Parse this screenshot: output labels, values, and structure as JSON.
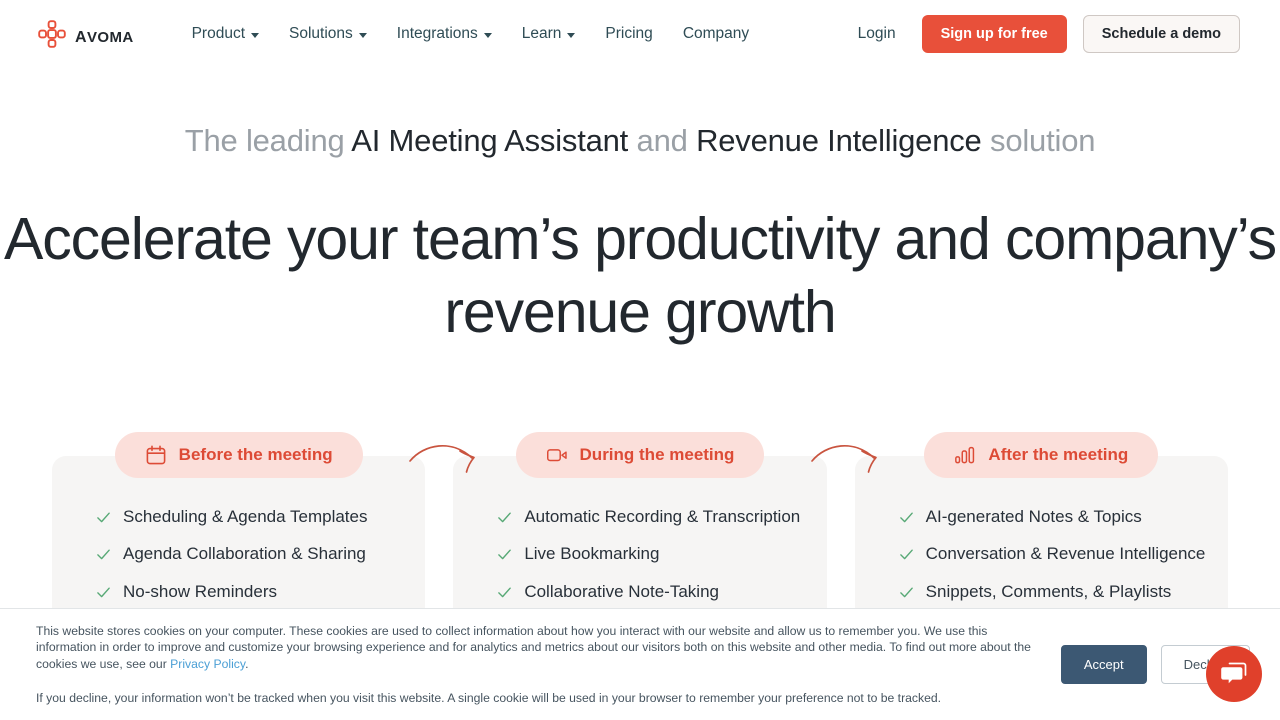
{
  "brand": {
    "word": "Avoma",
    "logo_icon": "avoma-cross-logo-icon",
    "accent": "#e8503a"
  },
  "nav": {
    "items": [
      {
        "label": "Product",
        "has_dropdown": true
      },
      {
        "label": "Solutions",
        "has_dropdown": true
      },
      {
        "label": "Integrations",
        "has_dropdown": true
      },
      {
        "label": "Learn",
        "has_dropdown": true
      },
      {
        "label": "Pricing",
        "has_dropdown": false
      },
      {
        "label": "Company",
        "has_dropdown": false
      }
    ],
    "login_label": "Login",
    "signup_label": "Sign up for free",
    "demo_label": "Schedule a demo"
  },
  "hero": {
    "eyebrow_parts": [
      {
        "text": "The leading ",
        "emphasis": false
      },
      {
        "text": "AI Meeting Assistant",
        "emphasis": true
      },
      {
        "text": " and ",
        "emphasis": false
      },
      {
        "text": "Revenue Intelligence",
        "emphasis": true
      },
      {
        "text": " solution",
        "emphasis": false
      }
    ],
    "headline": "Accelerate your team’s productivity and company’s revenue growth"
  },
  "stages": [
    {
      "badge_label": "Before the meeting",
      "badge_icon": "calendar-icon",
      "features": [
        "Scheduling & Agenda Templates",
        "Agenda Collaboration & Sharing",
        "No-show Reminders"
      ]
    },
    {
      "badge_label": "During the meeting",
      "badge_icon": "video-camera-icon",
      "features": [
        "Automatic Recording & Transcription",
        "Live Bookmarking",
        "Collaborative Note-Taking"
      ]
    },
    {
      "badge_label": "After the meeting",
      "badge_icon": "bar-chart-icon",
      "features": [
        "AI-generated Notes & Topics",
        "Conversation & Revenue Intelligence",
        "Snippets, Comments, & Playlists"
      ]
    }
  ],
  "cookie_banner": {
    "paragraph1_before_link": "This website stores cookies on your computer. These cookies are used to collect information about how you interact with our website and allow us to remember you. We use this information in order to improve and customize your browsing experience and for analytics and metrics about our visitors both on this website and other media. To find out more about the cookies we use, see our ",
    "link_label": "Privacy Policy",
    "paragraph1_after_link": ".",
    "paragraph2": "If you decline, your information won’t be tracked when you visit this website. A single cookie will be used in your browser to remember your preference not to be tracked.",
    "accept_label": "Accept",
    "decline_label": "Decline"
  },
  "chat": {
    "icon": "chat-bubble-icon",
    "color": "#e0402b"
  },
  "colors": {
    "brand_red": "#e8503a",
    "nav_text": "#2f4c55",
    "badge_bg": "#fbdfda",
    "badge_text": "#dd4b36",
    "card_bg": "#f6f5f4",
    "check_green": "#58a976",
    "accept_blue": "#3c5873",
    "link_blue": "#4b9fd5"
  }
}
